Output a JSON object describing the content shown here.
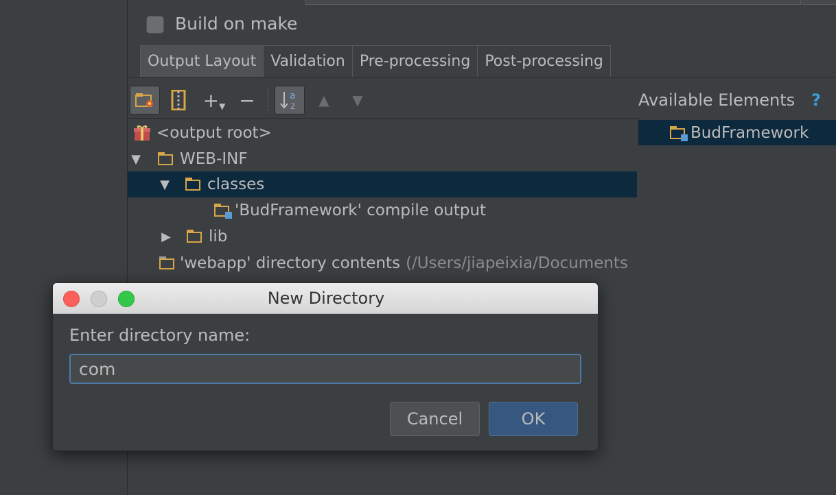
{
  "build_on_make": {
    "label": "Build on make",
    "checked": false
  },
  "tabs": [
    {
      "label": "Output Layout",
      "active": true
    },
    {
      "label": "Validation",
      "active": false
    },
    {
      "label": "Pre-processing",
      "active": false
    },
    {
      "label": "Post-processing",
      "active": false
    }
  ],
  "toolbar": {
    "new_directory_icon": "folder-new-icon",
    "archive_icon": "archive-icon",
    "add_icon": "+",
    "remove_icon": "−",
    "sort_icon": "sort-az-icon",
    "move_up_icon": "▲",
    "move_down_icon": "▼"
  },
  "tree": {
    "root": "<output root>",
    "web_inf": "WEB-INF",
    "classes": "classes",
    "compile_output": "'BudFramework' compile output",
    "lib": "lib",
    "webapp_contents": "'webapp' directory contents",
    "webapp_path": "(/Users/jiapeixia/Documents"
  },
  "available": {
    "title": "Available Elements",
    "help": "?",
    "items": [
      "BudFramework"
    ]
  },
  "dialog": {
    "title": "New Directory",
    "prompt": "Enter directory name:",
    "input_value": "com",
    "cancel_label": "Cancel",
    "ok_label": "OK"
  },
  "colors": {
    "background": "#3c3f41",
    "selection": "#0d293e",
    "folder": "#d8a548",
    "accent_button": "#365880",
    "help": "#3c9cd7"
  }
}
